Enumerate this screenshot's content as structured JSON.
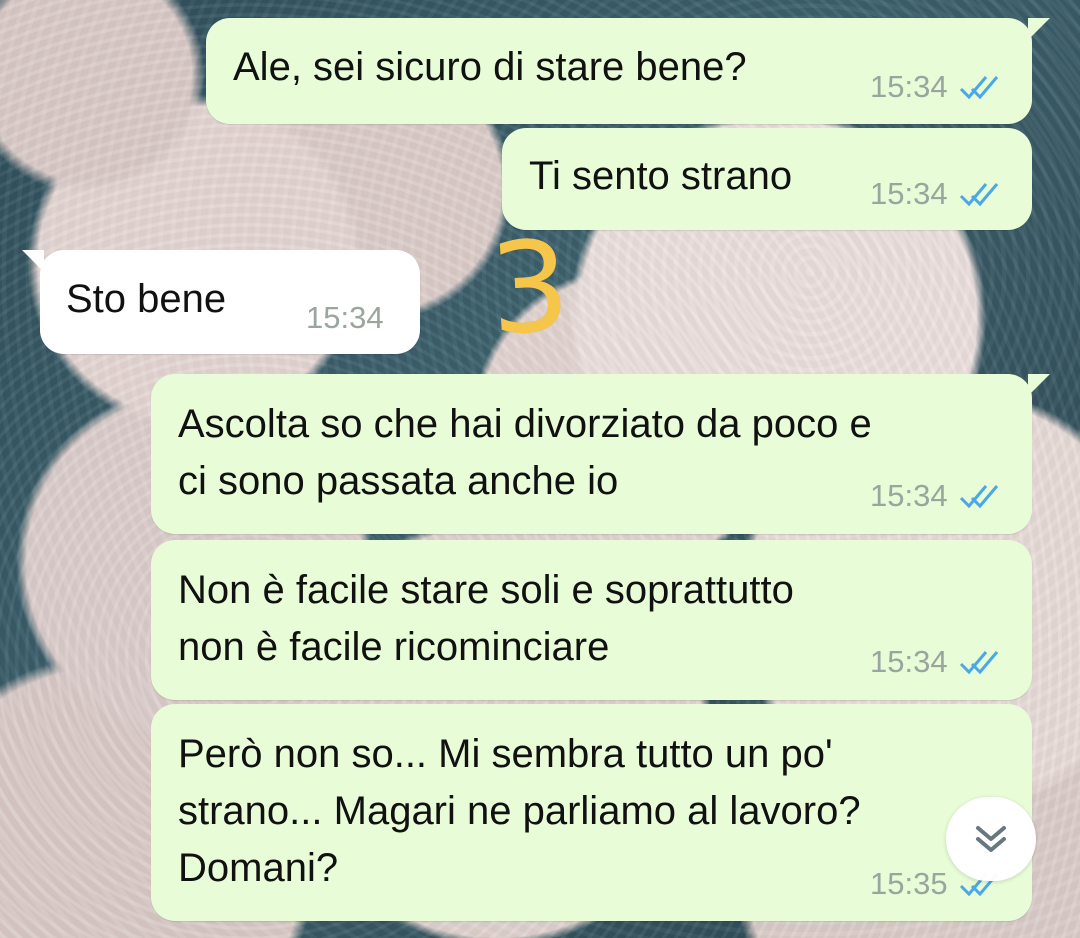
{
  "chat": {
    "messages": [
      {
        "type": "outgoing",
        "lines": [
          "Ale, sei sicuro di stare bene?"
        ],
        "time": "15:34",
        "status_icon": "double-check-icon"
      },
      {
        "type": "outgoing",
        "lines": [
          "Ti sento strano"
        ],
        "time": "15:34",
        "status_icon": "double-check-icon"
      },
      {
        "type": "incoming",
        "lines": [
          "Sto bene"
        ],
        "time": "15:34"
      },
      {
        "type": "outgoing",
        "lines": [
          "Ascolta so che hai divorziato da poco e",
          "ci sono passata anche io"
        ],
        "time": "15:34",
        "status_icon": "double-check-icon"
      },
      {
        "type": "outgoing",
        "lines": [
          "Non è facile stare soli e soprattutto",
          "non è facile ricominciare"
        ],
        "time": "15:34",
        "status_icon": "double-check-icon"
      },
      {
        "type": "outgoing",
        "lines": [
          "Però non so... Mi sembra tutto un po'",
          "strano... Magari ne parliamo al lavoro?",
          "Domani?"
        ],
        "time": "15:35",
        "status_icon": "double-check-icon"
      }
    ],
    "annotation": "3",
    "scroll_button_icon": "double-chevron-down-icon"
  },
  "colors": {
    "outgoing_bubble": "#e8fcd8",
    "incoming_bubble": "#ffffff",
    "read_ticks": "#4aa8e8",
    "annotation": "#f6c64b",
    "timestamp": "#9aa59d"
  }
}
